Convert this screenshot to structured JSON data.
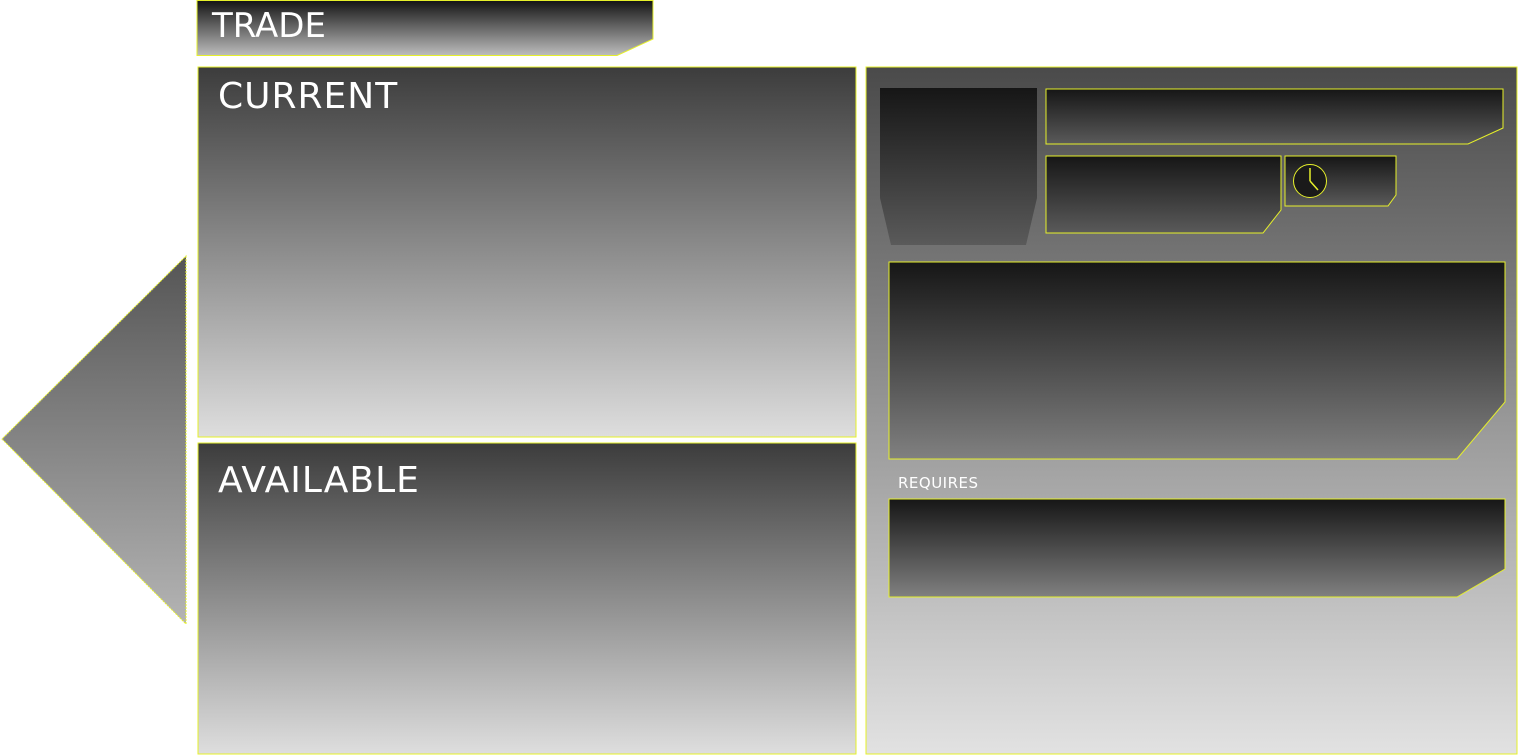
{
  "header": {
    "title": "TRADE"
  },
  "panels": {
    "current": {
      "title": "CURRENT"
    },
    "available": {
      "title": "AVAILABLE"
    },
    "details": {
      "requires_label": "REQUIRES"
    }
  },
  "icons": {
    "back": "back-arrow-icon",
    "clock": "clock-icon"
  },
  "colors": {
    "outline": "#e6f02a",
    "panel_dark": "#141414",
    "panel_light": "#dcdcdc",
    "text": "#ffffff"
  }
}
